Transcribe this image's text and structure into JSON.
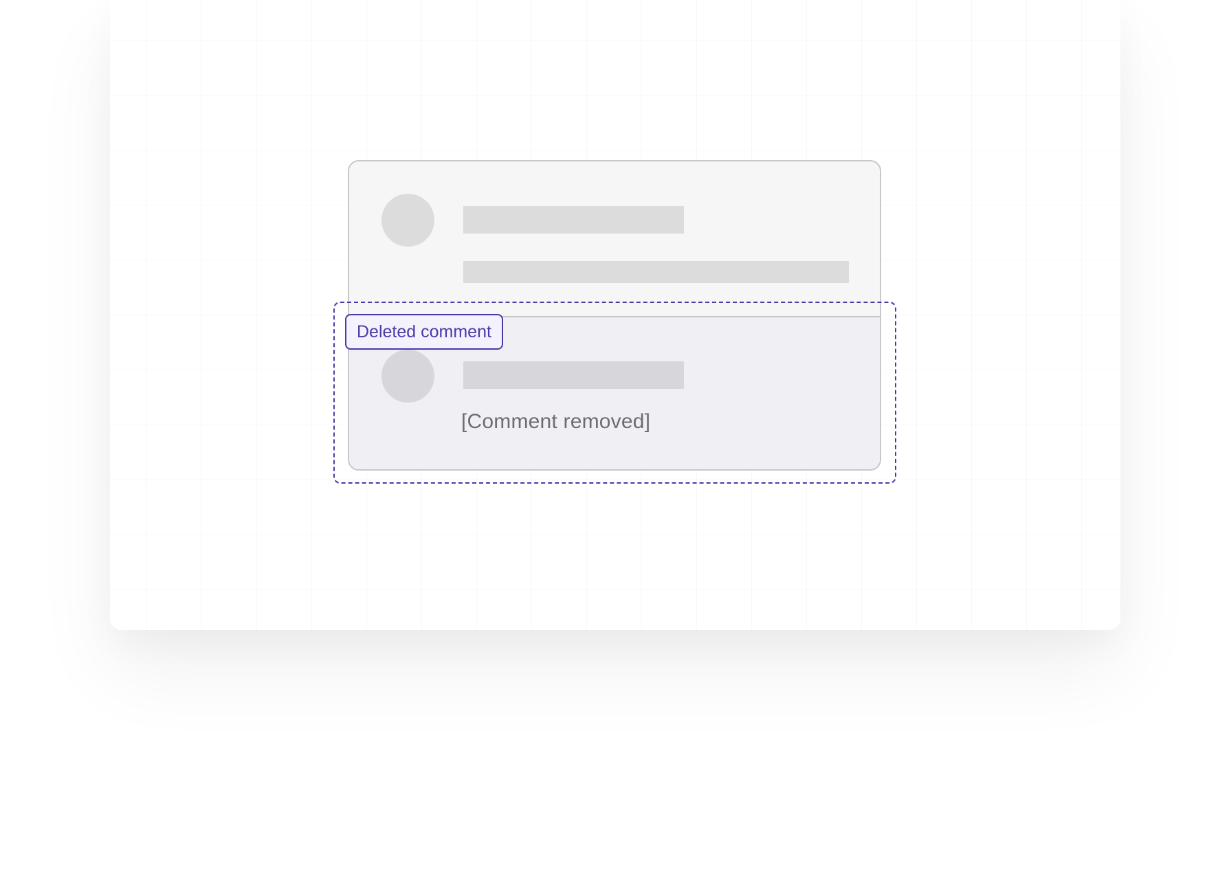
{
  "annotation": {
    "tag_label": "Deleted comment",
    "accent_color": "#4a3aa8"
  },
  "comment_thread": {
    "first_comment": {
      "state": "placeholder"
    },
    "second_comment": {
      "state": "deleted",
      "body_text": "[Comment removed]"
    }
  },
  "colors": {
    "placeholder_gray": "#dcdcdc",
    "deleted_background": "#f0eff4",
    "card_border": "#c8c8cc"
  }
}
